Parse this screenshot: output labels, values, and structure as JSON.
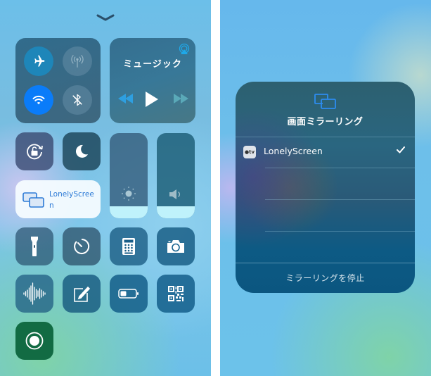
{
  "control_center": {
    "connectivity": {
      "airplane_mode": {
        "icon": "airplane-icon",
        "state": "on"
      },
      "cellular_data": {
        "icon": "cellular-antenna-icon",
        "state": "off"
      },
      "wifi": {
        "icon": "wifi-icon",
        "state": "on"
      },
      "bluetooth": {
        "icon": "bluetooth-off-icon",
        "state": "off"
      }
    },
    "music": {
      "title": "ミュージック",
      "airplay_icon": "airplay-icon",
      "controls": [
        "rewind-icon",
        "play-icon",
        "fast-forward-icon"
      ]
    },
    "rotation_lock": {
      "icon": "rotation-lock-icon"
    },
    "do_not_disturb": {
      "icon": "moon-icon"
    },
    "brightness": {
      "icon": "sun-icon",
      "level_percent": 14
    },
    "volume": {
      "icon": "speaker-icon",
      "level_percent": 14
    },
    "screen_mirroring": {
      "label": "LonelyScreen",
      "icon": "screen-mirroring-icon"
    },
    "shortcuts": [
      {
        "name": "flashlight",
        "icon": "flashlight-icon"
      },
      {
        "name": "timer",
        "icon": "timer-icon"
      },
      {
        "name": "calculator",
        "icon": "calculator-icon"
      },
      {
        "name": "camera",
        "icon": "camera-icon"
      },
      {
        "name": "voice-memos",
        "icon": "waveform-icon"
      },
      {
        "name": "notes",
        "icon": "note-pencil-icon"
      },
      {
        "name": "low-power-mode",
        "icon": "battery-icon"
      },
      {
        "name": "qr-scanner",
        "icon": "qr-code-icon"
      },
      {
        "name": "screen-recording",
        "icon": "record-icon"
      }
    ]
  },
  "mirroring_panel": {
    "title": "画面ミラーリング",
    "devices": [
      {
        "name": "LonelyScreen",
        "badge": "tv",
        "selected": true
      }
    ],
    "stop_label": "ミラーリングを停止"
  },
  "colors": {
    "accent_blue": "#0a7cf9",
    "airplane_on": "#1e86b9",
    "airplay_blue": "#1fa8e8",
    "recording_green": "#126b43",
    "slider_fill": "#bff2fb"
  }
}
